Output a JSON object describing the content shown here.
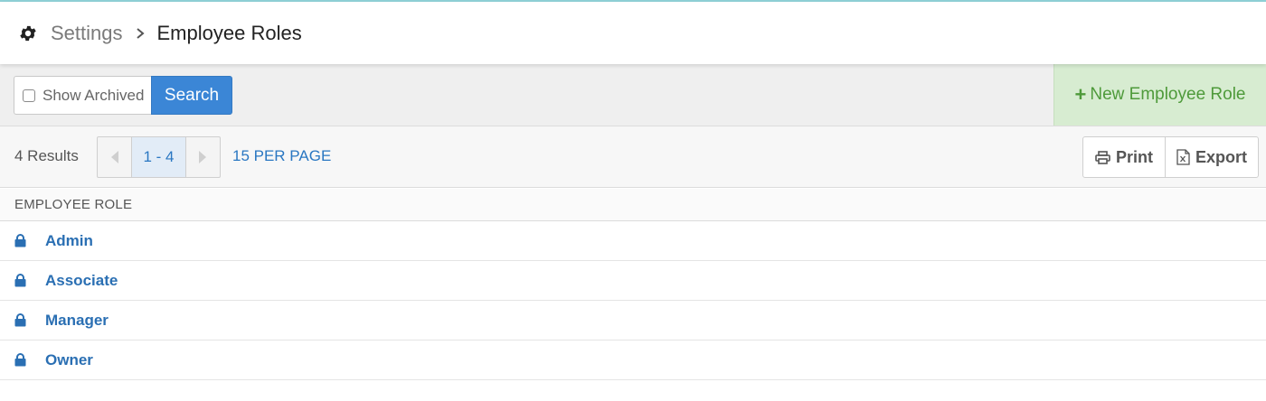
{
  "colors": {
    "accent": "#3b86d6",
    "link": "#2a6fb3",
    "new_button_bg": "#d7ecd1",
    "new_button_text": "#4e9a3a",
    "top_accent": "#8fd0d6"
  },
  "header": {
    "icon": "gear-icon",
    "breadcrumb_parent": "Settings",
    "breadcrumb_separator_icon": "chevron-right-icon",
    "breadcrumb_current": "Employee Roles"
  },
  "toolbar": {
    "show_archived_label": "Show Archived",
    "show_archived_checked": false,
    "search_label": "Search",
    "new_role_icon": "plus-icon",
    "new_role_plus": "+",
    "new_role_label": "New Employee Role"
  },
  "results": {
    "count_label": "4 Results",
    "pager_current": "1 - 4",
    "per_page_label": "15 PER PAGE",
    "print_icon": "printer-icon",
    "print_label": "Print",
    "export_icon": "excel-file-icon",
    "export_label": "Export"
  },
  "table": {
    "column_header": "EMPLOYEE ROLE",
    "row_icon": "lock-icon",
    "rows": [
      {
        "name": "Admin"
      },
      {
        "name": "Associate"
      },
      {
        "name": "Manager"
      },
      {
        "name": "Owner"
      }
    ]
  }
}
